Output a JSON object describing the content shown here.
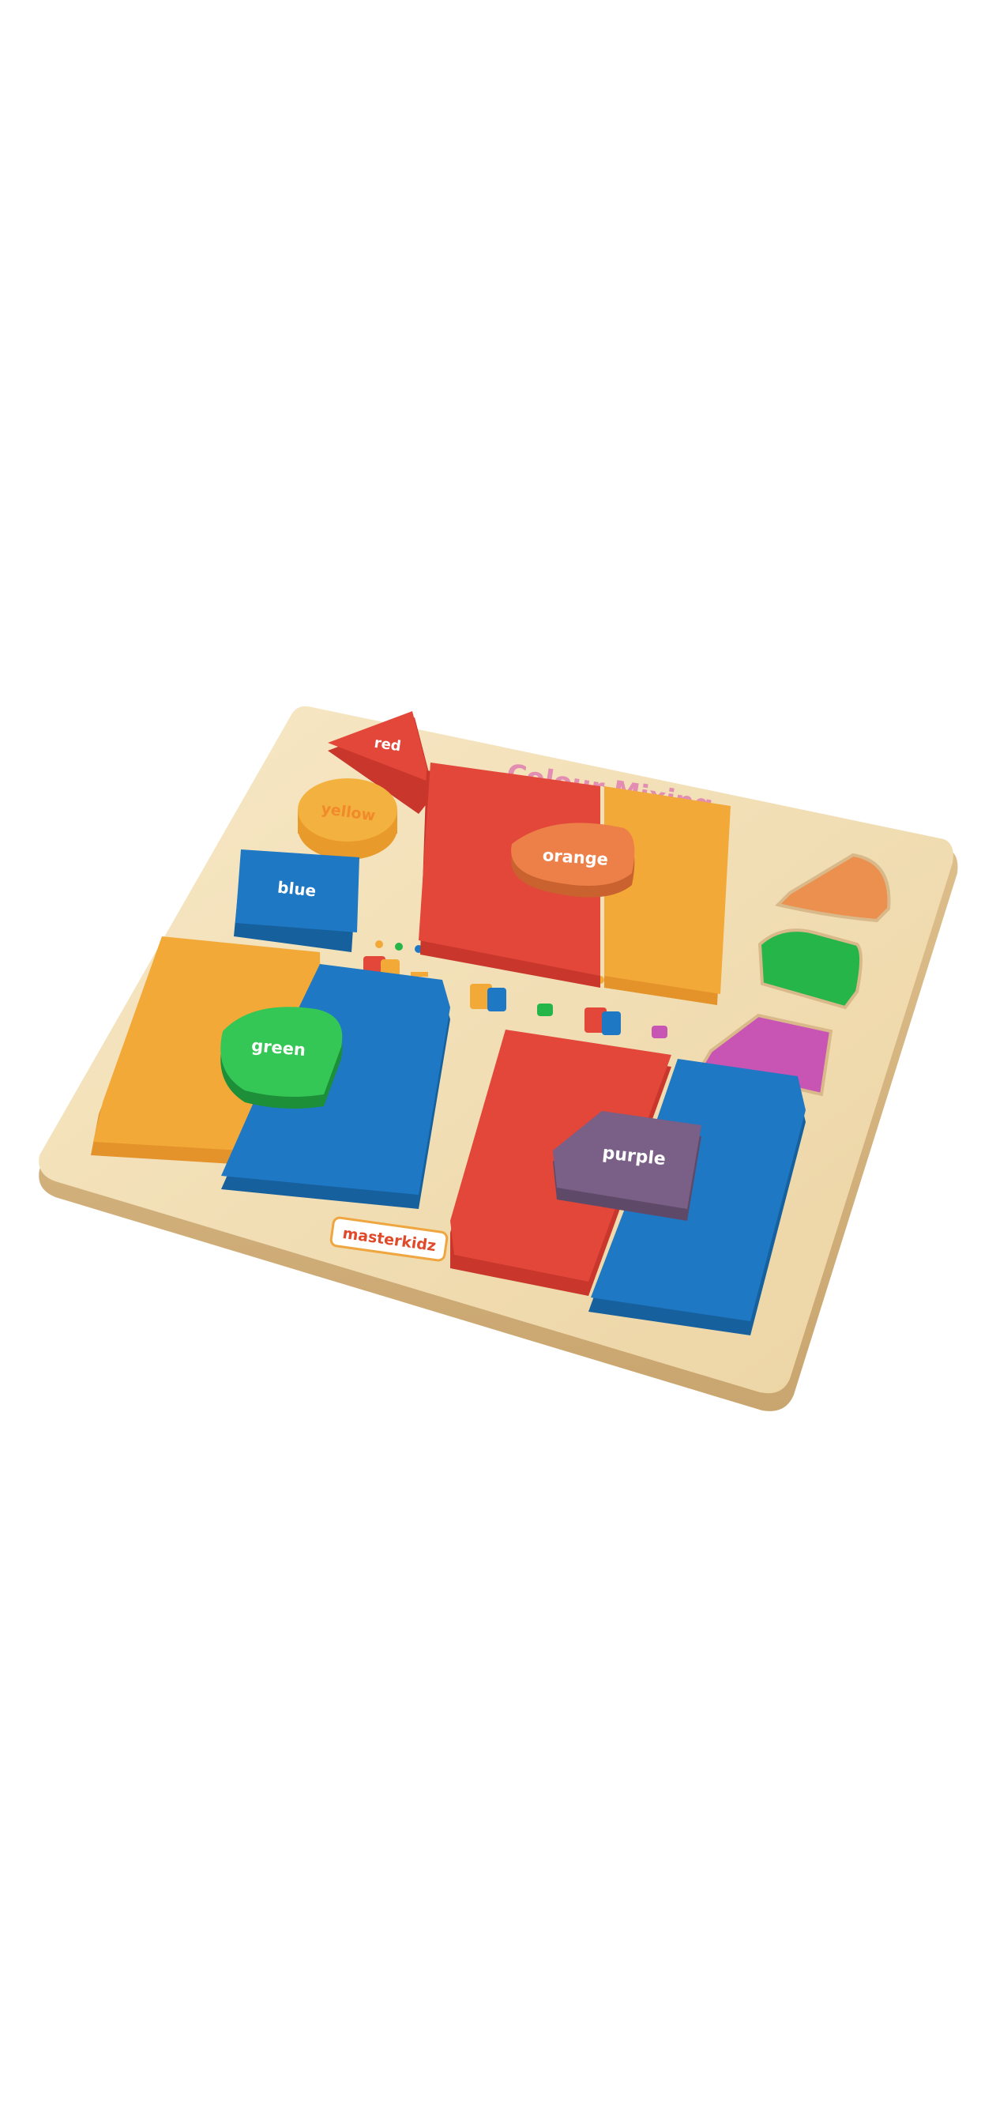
{
  "product": {
    "board_title": "Colour Mixing",
    "brand": "masterkidz"
  },
  "pieces": {
    "red": "red",
    "yellow": "yellow",
    "blue": "blue",
    "orange": "orange",
    "green": "green",
    "purple": "purple"
  },
  "colors": {
    "background": "#ffffff",
    "wood": "#f2dfb6",
    "wood_edge": "#d9b98a",
    "red": "#e2473a",
    "yellow": "#f3a938",
    "blue": "#1f78c4",
    "orange": "#ec8048",
    "green": "#26b548",
    "purple": "#7a5f86",
    "magenta": "#c854b4"
  }
}
